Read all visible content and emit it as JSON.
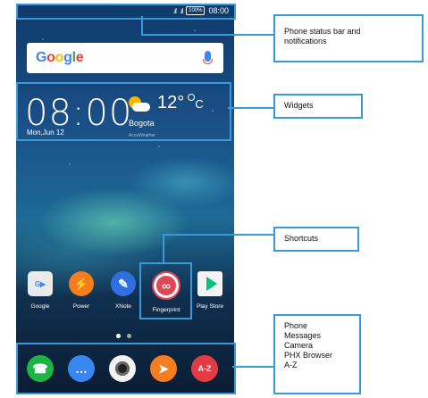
{
  "statusbar": {
    "signal1": ".ıl",
    "signal2": ".ıl",
    "battery": "100%",
    "time": "08:00"
  },
  "search": {
    "logo": [
      "G",
      "o",
      "o",
      "g",
      "l",
      "e"
    ]
  },
  "clock_widget": {
    "time": "08:00",
    "date": "Mon,Jun 12"
  },
  "weather_widget": {
    "temp": "12°",
    "unit": "C",
    "city": "Bogota",
    "source": "AccuWeather"
  },
  "apps": [
    {
      "label": "Google",
      "icon": "google-folder-icon"
    },
    {
      "label": "Power",
      "icon": "power-icon"
    },
    {
      "label": "XNote",
      "icon": "xnote-icon"
    },
    {
      "label": "Fingerprint",
      "icon": "fingerprint-icon"
    },
    {
      "label": "Play Store",
      "icon": "play-store-icon"
    }
  ],
  "dock": [
    {
      "icon": "phone-icon"
    },
    {
      "icon": "messages-icon"
    },
    {
      "icon": "camera-icon"
    },
    {
      "icon": "phx-browser-icon"
    },
    {
      "icon": "a-z-icon"
    }
  ],
  "callouts": {
    "status": [
      "Phone status bar and",
      "notifications"
    ],
    "widgets": "Widgets",
    "shortcuts": "Shortcuts",
    "dock": [
      "Phone",
      "Messages",
      "Camera",
      "PHX Browser",
      "A-Z"
    ]
  }
}
